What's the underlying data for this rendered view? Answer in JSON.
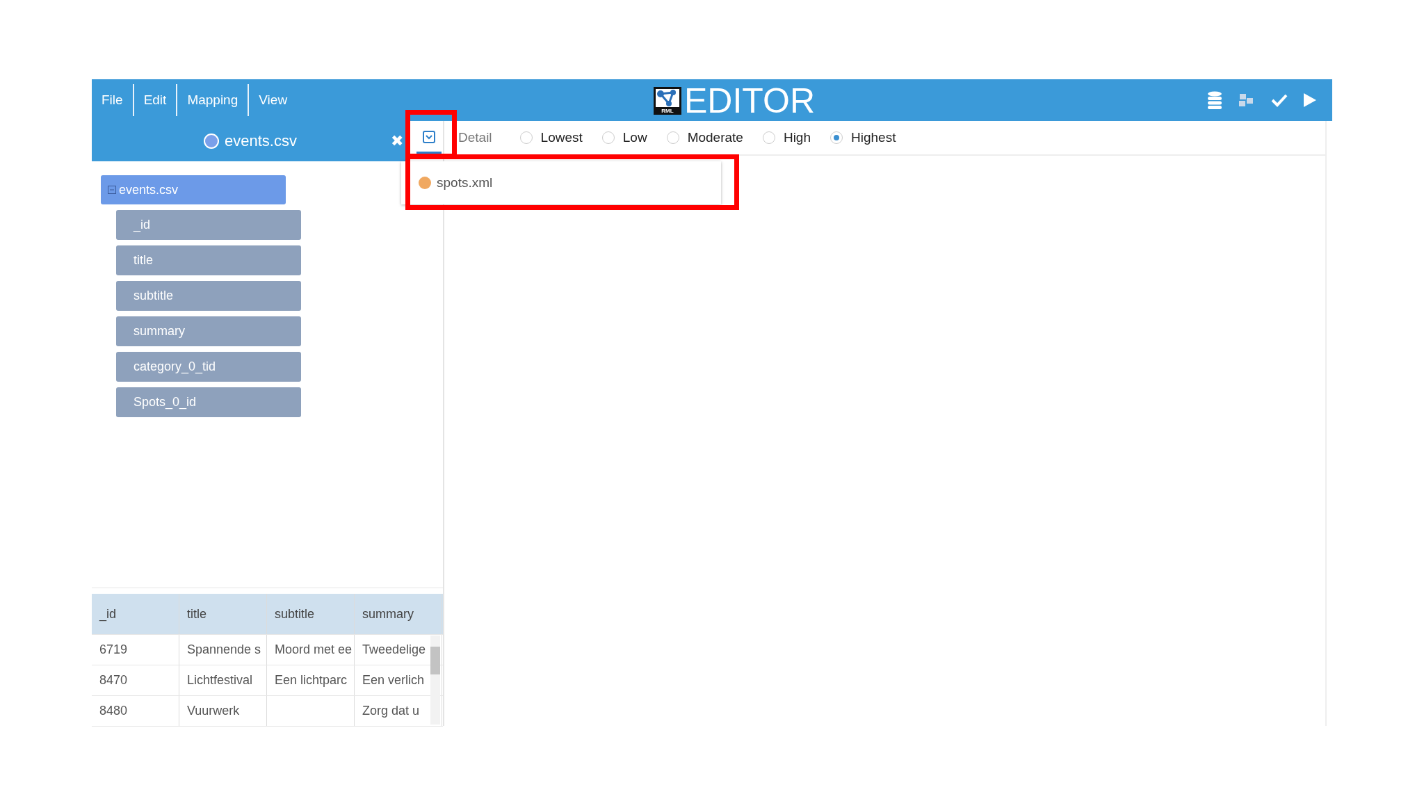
{
  "menu": [
    {
      "label": "File"
    },
    {
      "label": "Edit"
    },
    {
      "label": "Mapping"
    },
    {
      "label": "View"
    }
  ],
  "logo": {
    "text": "EDITOR",
    "badge": "RML"
  },
  "source_tab": {
    "label": "events.csv",
    "close": "✖"
  },
  "detail": {
    "label": "Detail",
    "options": [
      {
        "label": "Lowest",
        "selected": false
      },
      {
        "label": "Low",
        "selected": false
      },
      {
        "label": "Moderate",
        "selected": false
      },
      {
        "label": "High",
        "selected": false
      },
      {
        "label": "Highest",
        "selected": true
      }
    ]
  },
  "dropdown": {
    "items": [
      {
        "label": "spots.xml",
        "color": "#f0a860"
      }
    ]
  },
  "tree": {
    "label": "events.csv",
    "expanded": true,
    "children": [
      {
        "label": "_id"
      },
      {
        "label": "title"
      },
      {
        "label": "subtitle"
      },
      {
        "label": "summary"
      },
      {
        "label": "category_0_tid"
      },
      {
        "label": "Spots_0_id"
      }
    ]
  },
  "table": {
    "columns": [
      "_id",
      "title",
      "subtitle",
      "summary"
    ],
    "rows": [
      [
        "6719",
        "Spannende s",
        "Moord met ee",
        "Tweedelige"
      ],
      [
        "8470",
        "Lichtfestival",
        "Een lichtparc",
        "Een verlich"
      ],
      [
        "8480",
        "Vuurwerk",
        "",
        "Zorg dat u"
      ]
    ]
  }
}
